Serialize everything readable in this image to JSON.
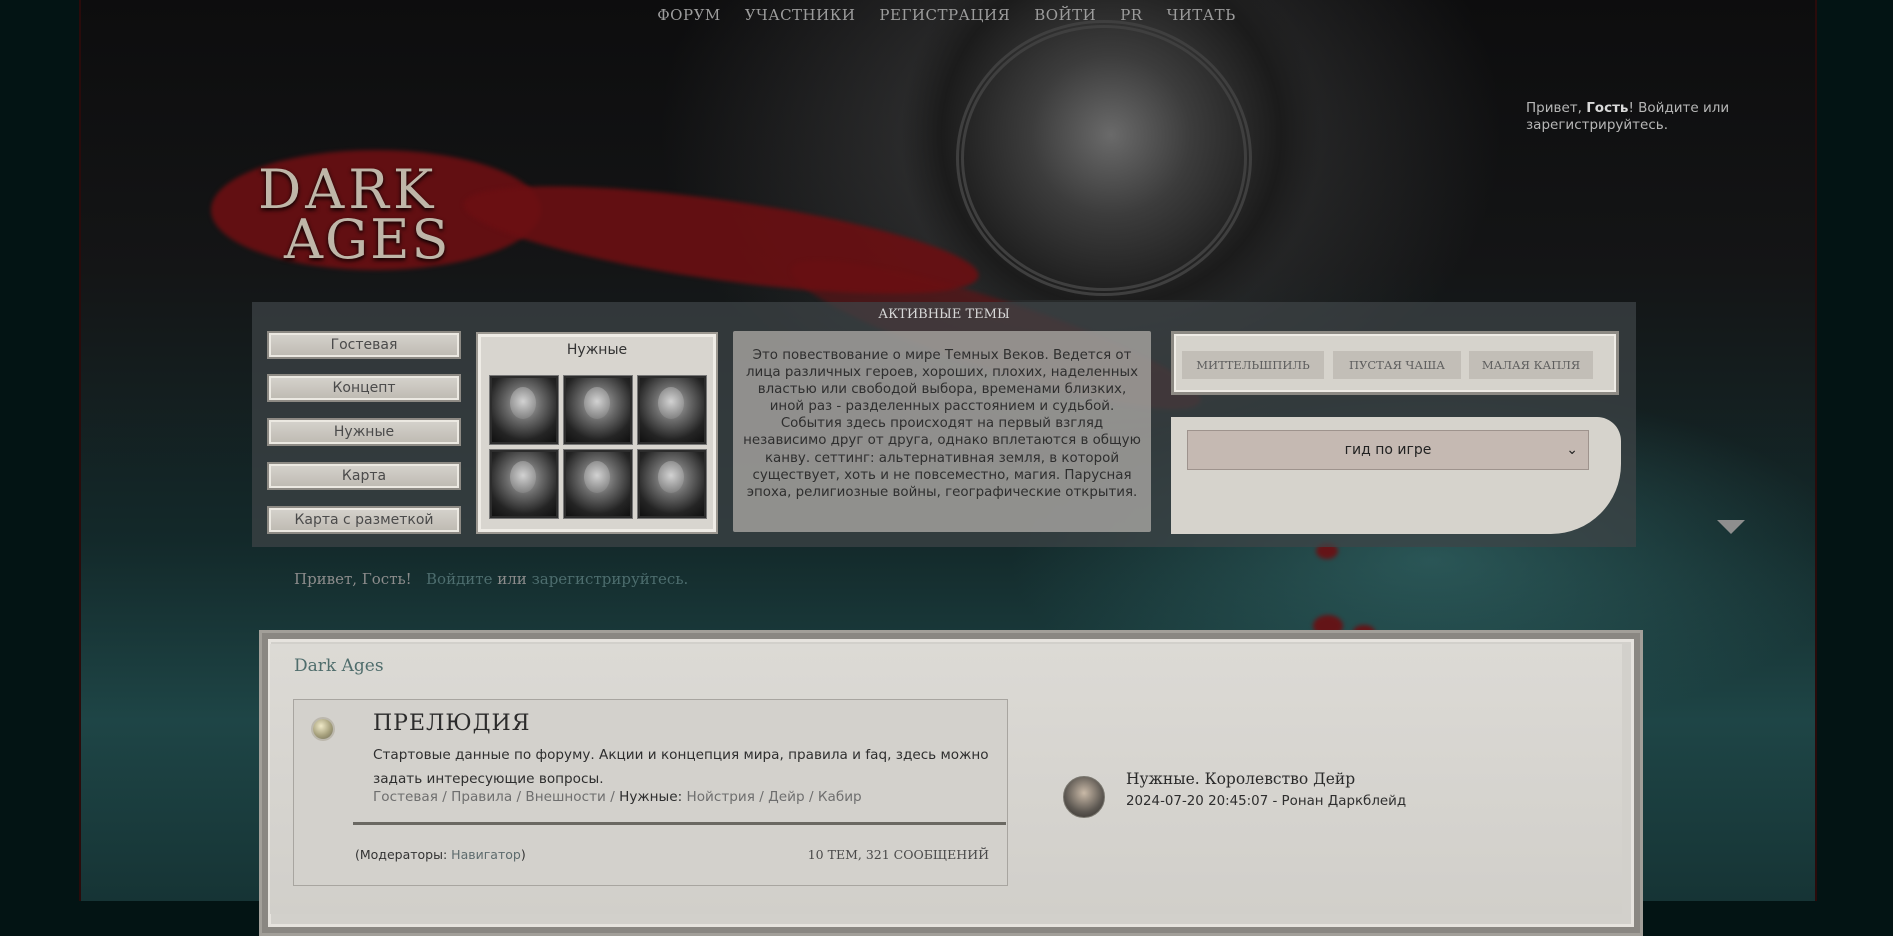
{
  "nav": {
    "items": [
      "ФОРУМ",
      "УЧАСТНИКИ",
      "РЕГИСТРАЦИЯ",
      "ВОЙТИ",
      "PR",
      "ЧИТАТЬ"
    ]
  },
  "logo": {
    "line1": "DARK",
    "line2": "AGES"
  },
  "header_greeting": {
    "prefix": "Привет, ",
    "guest": "Гость",
    "suffix": "! Войдите или зарегистрируйтесь."
  },
  "active_topics": {
    "title": "АКТИВНЫЕ ТЕМЫ"
  },
  "side_buttons": [
    "Гостевая",
    "Концепт",
    "Нужные",
    "Карта",
    "Карта с разметкой"
  ],
  "needed": {
    "title": "Нужные"
  },
  "description": "Это повествование о мире Темных Веков. Ведется от лица различных героев, хороших, плохих, наделенных властью или свободой выбора, временами близких, иной раз - разделенных расстоянием и судьбой. События здесь происходят на первый взгляд независимо друг от друга, однако вплетаются в общую канву. сеттинг: альтернативная земля, в которой существует, хоть и не повсеместно, магия. Парусная эпоха, религиозные войны, географические открытия.",
  "tags": [
    "МИТТЕЛЬШПИЛЬ",
    "ПУСТАЯ ЧАША",
    "МАЛАЯ КАПЛЯ"
  ],
  "guide_select": {
    "value": "гид по игре",
    "chevron": "⌄"
  },
  "mid_greeting": {
    "hello": "Привет, Гость!",
    "login": "Войдите",
    "or": "или",
    "register": "зарегистрируйтесь."
  },
  "main": {
    "section_title": "Dark Ages",
    "forum": {
      "name": "ПРЕЛЮДИЯ",
      "description": "Стартовые данные по форуму. Акции и концепция мира, правила и faq, здесь можно задать интересующие вопросы.",
      "links": [
        "Гостевая",
        "Правила",
        "Внешности"
      ],
      "needed_label": "Нужные:",
      "needed_links": [
        "Нойстрия",
        "Дейр",
        "Кабир"
      ],
      "moderators_label": "(Модераторы:",
      "moderator": "Навигатор",
      "moderators_close": ")",
      "counts": "10 тем, 321 сообщений"
    },
    "last_post": {
      "title": "Нужные. Королевство Дейр",
      "meta": "2024-07-20 20:45:07 - Ронан Даркблейд"
    }
  },
  "colors": {
    "accent": "#4f6d6c",
    "blood": "#6b0f12",
    "panel": "#d6d3cc"
  }
}
